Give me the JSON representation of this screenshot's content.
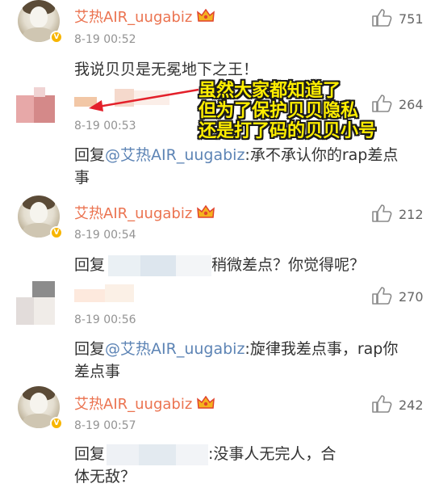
{
  "comments": [
    {
      "username": "艾热AIR_uugabiz",
      "time": "8-19 00:52",
      "text": "我说贝贝是无冕地下之王！",
      "likes": "751"
    },
    {
      "username": "",
      "time": "8-19 00:53",
      "reply_prefix": "回复",
      "mention": "@艾热AIR_uugabiz",
      "text": ":承不承认你的rap差点事",
      "likes": "264"
    },
    {
      "username": "艾热AIR_uugabiz",
      "time": "8-19 00:54",
      "reply_prefix": "回复",
      "text": "稍微差点？你觉得呢？",
      "likes": "212"
    },
    {
      "username": "",
      "time": "8-19 00:56",
      "reply_prefix": "回复",
      "mention": "@艾热AIR_uugabiz",
      "text": ":旋律我差点事，rap你差点事",
      "likes": "270"
    },
    {
      "username": "艾热AIR_uugabiz",
      "time": "8-19 00:57",
      "reply_prefix": "回复",
      "text": ":没事人无完人，合体无敌？",
      "likes": "242"
    }
  ],
  "annotation": {
    "lines": [
      "虽然大家都知道了",
      "但为了保护贝贝隐私",
      "还是打了码的贝贝小号"
    ],
    "color": "#ffee00"
  },
  "colors": {
    "username": "#eb7350",
    "mention": "#5d84b5",
    "time": "#939393",
    "text": "#333333"
  },
  "icons": {
    "like": "thumbs-up-icon",
    "verified": "verified-badge-icon",
    "vip": "crown-badge-icon"
  }
}
